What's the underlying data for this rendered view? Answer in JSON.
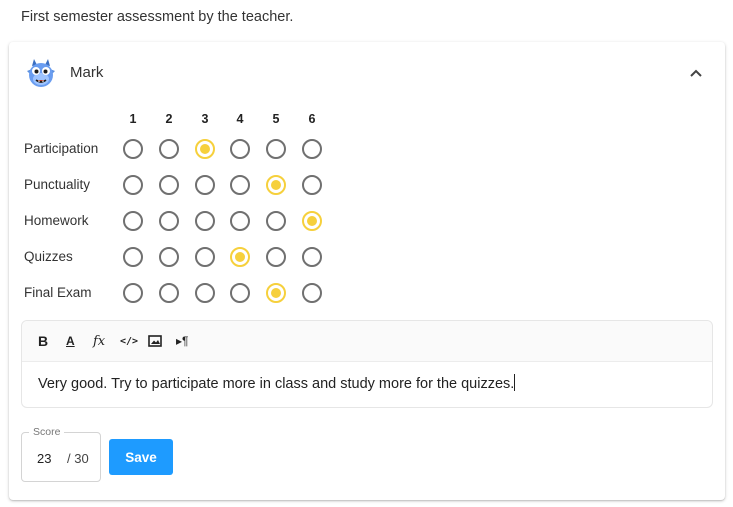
{
  "intro_text": "First semester assessment by the teacher.",
  "student": {
    "name": "Mark",
    "avatar": "monster-avatar-icon"
  },
  "grid": {
    "columns": [
      "1",
      "2",
      "3",
      "4",
      "5",
      "6"
    ],
    "criteria": [
      {
        "label": "Participation",
        "selected": 3
      },
      {
        "label": "Punctuality",
        "selected": 5
      },
      {
        "label": "Homework",
        "selected": 6
      },
      {
        "label": "Quizzes",
        "selected": 4
      },
      {
        "label": "Final Exam",
        "selected": 5
      }
    ]
  },
  "editor": {
    "toolbar": [
      "bold-icon",
      "font-color-icon",
      "formula-icon",
      "code-icon",
      "image-icon",
      "paragraph-icon"
    ],
    "bold_label": "B",
    "font_color_label": "A",
    "formula_label": "fx",
    "code_label": "</>",
    "paragraph_label": "▸¶",
    "text": "Very good. Try to participate more in class and study more for the quizzes."
  },
  "score": {
    "label": "Score",
    "value": "23",
    "max": "/ 30"
  },
  "save_label": "Save",
  "colors": {
    "accent_radio": "#f6d03c",
    "save_button": "#1e9bff"
  }
}
